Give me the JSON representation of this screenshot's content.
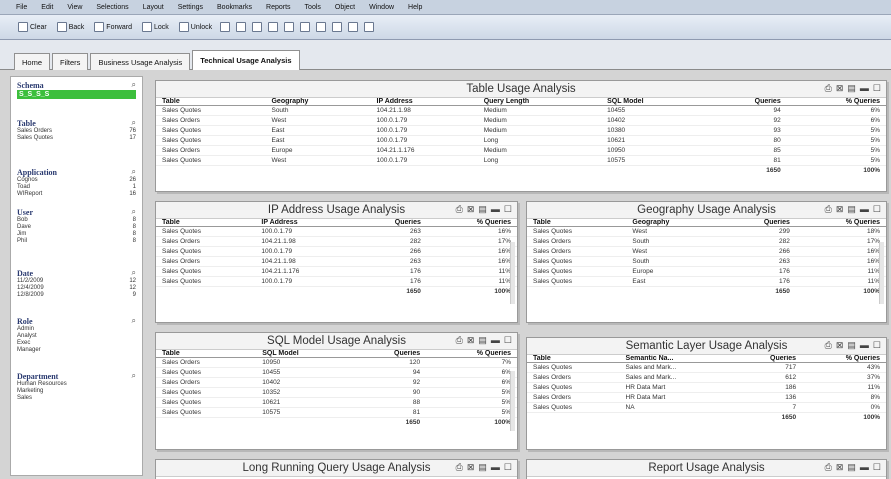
{
  "menu": [
    "File",
    "Edit",
    "View",
    "Selections",
    "Layout",
    "Settings",
    "Bookmarks",
    "Reports",
    "Tools",
    "Object",
    "Window",
    "Help"
  ],
  "toolbar": {
    "clear": "Clear",
    "back": "Back",
    "forward": "Forward",
    "lock": "Lock",
    "unlock": "Unlock"
  },
  "tabs": [
    {
      "label": "Home"
    },
    {
      "label": "Filters"
    },
    {
      "label": "Business Usage Analysis"
    },
    {
      "label": "Technical Usage Analysis"
    }
  ],
  "sidebar": {
    "schema": {
      "title": "Schema",
      "selected": "S_S_S_S"
    },
    "table": {
      "title": "Table",
      "items": [
        {
          "name": "Sales Orders",
          "count": "76"
        },
        {
          "name": "Sales Quotes",
          "count": "17"
        }
      ]
    },
    "application": {
      "title": "Application",
      "items": [
        {
          "name": "Cognos",
          "count": "26"
        },
        {
          "name": "Toad",
          "count": "1"
        },
        {
          "name": "WIReport",
          "count": "16"
        }
      ]
    },
    "user": {
      "title": "User",
      "items": [
        {
          "name": "Bob",
          "count": "8"
        },
        {
          "name": "Dave",
          "count": "8"
        },
        {
          "name": "Jim",
          "count": "8"
        },
        {
          "name": "Phil",
          "count": "8"
        }
      ]
    },
    "date": {
      "title": "Date",
      "items": [
        {
          "name": "11/2/2009",
          "count": "12"
        },
        {
          "name": "12/4/2009",
          "count": "12"
        },
        {
          "name": "12/8/2009",
          "count": "9"
        }
      ]
    },
    "role": {
      "title": "Role",
      "items": [
        {
          "name": "Admin",
          "count": ""
        },
        {
          "name": "Analyst",
          "count": ""
        },
        {
          "name": "Exec",
          "count": ""
        },
        {
          "name": "Manager",
          "count": ""
        }
      ]
    },
    "department": {
      "title": "Department",
      "items": [
        {
          "name": "Human Resources",
          "count": ""
        },
        {
          "name": "Marketing",
          "count": ""
        },
        {
          "name": "Sales",
          "count": ""
        }
      ]
    }
  },
  "table_usage": {
    "title": "Table Usage Analysis",
    "headers": [
      "Table",
      "Geography",
      "IP Address",
      "Query Length",
      "SQL Model",
      "Queries",
      "% Queries"
    ],
    "rows": [
      [
        "Sales Quotes",
        "South",
        "104.21.1.98",
        "Medium",
        "10455",
        "94",
        "6%"
      ],
      [
        "Sales Orders",
        "West",
        "100.0.1.79",
        "Medium",
        "10402",
        "92",
        "6%"
      ],
      [
        "Sales Quotes",
        "East",
        "100.0.1.79",
        "Medium",
        "10380",
        "93",
        "5%"
      ],
      [
        "Sales Quotes",
        "East",
        "100.0.1.79",
        "Long",
        "10621",
        "80",
        "5%"
      ],
      [
        "Sales Orders",
        "Europe",
        "104.21.1.176",
        "Medium",
        "10950",
        "85",
        "5%"
      ],
      [
        "Sales Quotes",
        "West",
        "100.0.1.79",
        "Long",
        "10575",
        "81",
        "5%"
      ]
    ],
    "total": [
      "",
      "",
      "",
      "",
      "",
      "1650",
      "100%"
    ]
  },
  "ip_usage": {
    "title": "IP Address Usage Analysis",
    "headers": [
      "Table",
      "IP Address",
      "Queries",
      "% Queries"
    ],
    "rows": [
      [
        "Sales Quotes",
        "100.0.1.79",
        "263",
        "16%"
      ],
      [
        "Sales Orders",
        "104.21.1.98",
        "282",
        "17%"
      ],
      [
        "Sales Quotes",
        "100.0.1.79",
        "266",
        "16%"
      ],
      [
        "Sales Orders",
        "104.21.1.98",
        "263",
        "16%"
      ],
      [
        "Sales Quotes",
        "104.21.1.176",
        "176",
        "11%"
      ],
      [
        "Sales Quotes",
        "100.0.1.79",
        "176",
        "11%"
      ]
    ],
    "total": [
      "",
      "",
      "1650",
      "100%"
    ]
  },
  "geo_usage": {
    "title": "Geography Usage Analysis",
    "headers": [
      "Table",
      "Geography",
      "Queries",
      "% Queries"
    ],
    "rows": [
      [
        "Sales Quotes",
        "West",
        "299",
        "18%"
      ],
      [
        "Sales Orders",
        "South",
        "282",
        "17%"
      ],
      [
        "Sales Orders",
        "West",
        "266",
        "16%"
      ],
      [
        "Sales Quotes",
        "South",
        "263",
        "16%"
      ],
      [
        "Sales Quotes",
        "Europe",
        "176",
        "11%"
      ],
      [
        "Sales Quotes",
        "East",
        "176",
        "11%"
      ]
    ],
    "total": [
      "",
      "",
      "1650",
      "100%"
    ]
  },
  "sql_usage": {
    "title": "SQL Model Usage Analysis",
    "headers": [
      "Table",
      "SQL Model",
      "Queries",
      "% Queries"
    ],
    "rows": [
      [
        "Sales Orders",
        "10950",
        "120",
        "7%"
      ],
      [
        "Sales Quotes",
        "10455",
        "94",
        "6%"
      ],
      [
        "Sales Orders",
        "10402",
        "92",
        "6%"
      ],
      [
        "Sales Quotes",
        "10352",
        "90",
        "5%"
      ],
      [
        "Sales Quotes",
        "10621",
        "88",
        "5%"
      ],
      [
        "Sales Quotes",
        "10575",
        "81",
        "5%"
      ]
    ],
    "total": [
      "",
      "",
      "1650",
      "100%"
    ]
  },
  "semantic_usage": {
    "title": "Semantic Layer Usage Analysis",
    "headers": [
      "Table",
      "Semantic Na...",
      "Queries",
      "% Queries"
    ],
    "rows": [
      [
        "Sales Quotes",
        "Sales and Mark...",
        "717",
        "43%"
      ],
      [
        "Sales Orders",
        "Sales and Mark...",
        "612",
        "37%"
      ],
      [
        "Sales Quotes",
        "HR Data Mart",
        "186",
        "11%"
      ],
      [
        "Sales Orders",
        "HR Data Mart",
        "136",
        "8%"
      ],
      [
        "Sales Quotes",
        "NA",
        "7",
        "0%"
      ]
    ],
    "total": [
      "",
      "",
      "1650",
      "100%"
    ]
  },
  "long_running": {
    "title": "Long Running Query Usage Analysis"
  },
  "report_usage": {
    "title": "Report Usage Analysis"
  },
  "colors": {
    "selected": "#3cbf3c",
    "title_text": "#2a3a70"
  }
}
